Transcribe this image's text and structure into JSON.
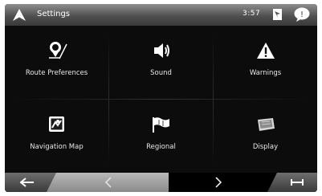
{
  "header": {
    "title": "Settings",
    "time": "3:57"
  },
  "menu": [
    {
      "label": "Route Preferences",
      "icon": "route-preferences-icon"
    },
    {
      "label": "Sound",
      "icon": "speaker-icon"
    },
    {
      "label": "Warnings",
      "icon": "warning-icon"
    },
    {
      "label": "Navigation Map",
      "icon": "map-icon"
    },
    {
      "label": "Regional",
      "icon": "flag-icon"
    },
    {
      "label": "Display",
      "icon": "display-icon"
    }
  ],
  "colors": {
    "background": "#0c0c0c",
    "text": "#e8e8e8",
    "accent": "#ffffff"
  }
}
